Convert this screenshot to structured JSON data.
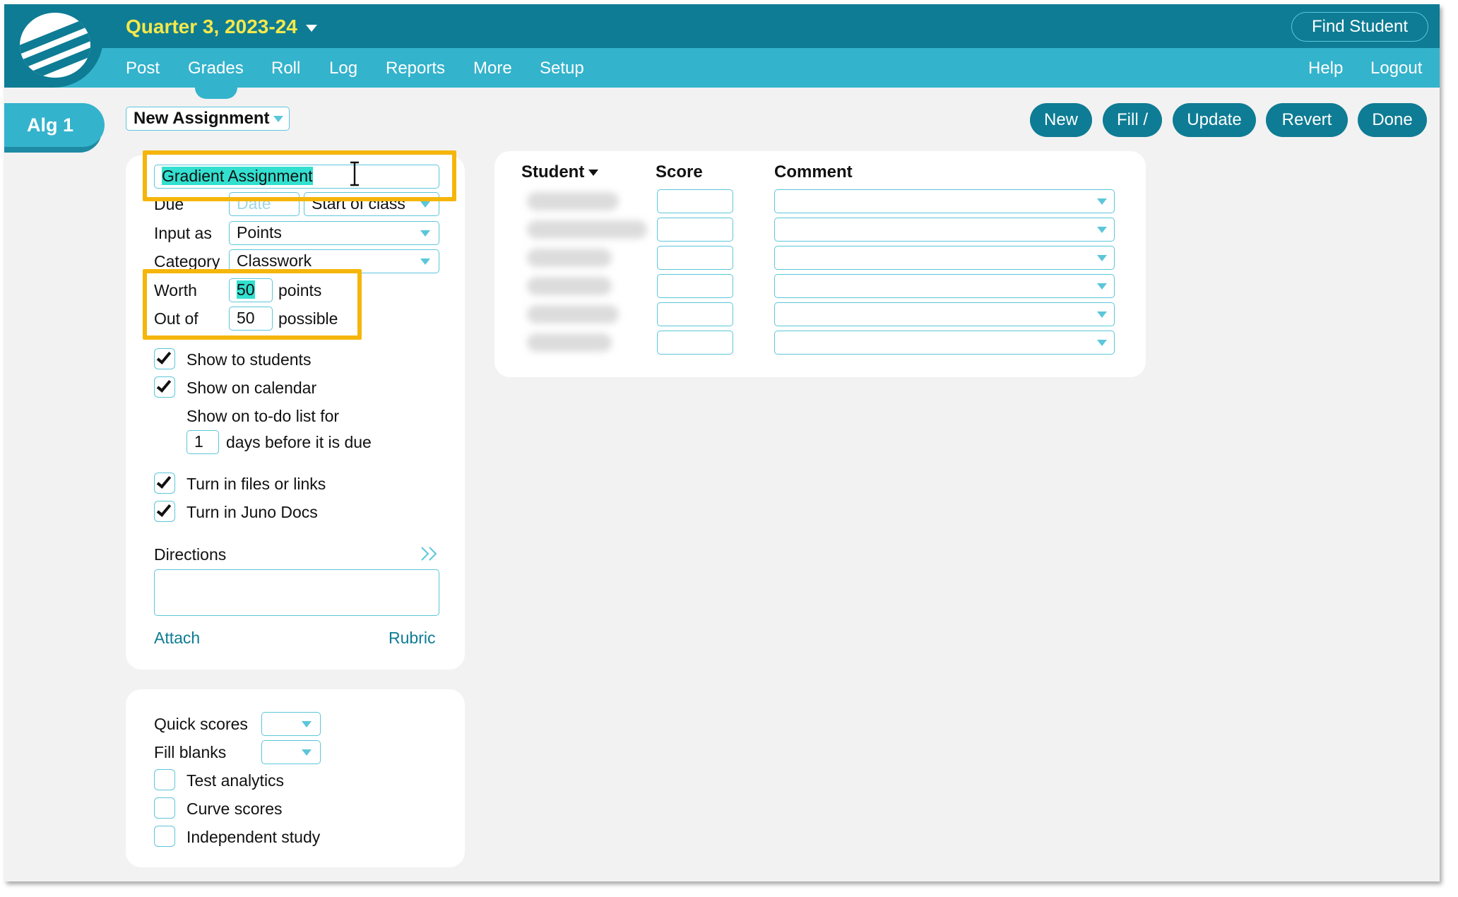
{
  "header": {
    "quarter": "Quarter 3, 2023-24",
    "find_student": "Find Student",
    "nav": [
      "Post",
      "Grades",
      "Roll",
      "Log",
      "Reports",
      "More",
      "Setup"
    ],
    "help": "Help",
    "logout": "Logout"
  },
  "class_tab": "Alg 1",
  "toolbar": {
    "assignment_select": "New Assignment",
    "buttons": [
      "New",
      "Fill /",
      "Update",
      "Revert",
      "Done"
    ]
  },
  "assignment": {
    "name": "Gradient Assignment",
    "due_label": "Due",
    "due_date_placeholder": "Date",
    "due_time": "Start of class",
    "input_as_label": "Input as",
    "input_as": "Points",
    "category_label": "Category",
    "category": "Classwork",
    "worth_label": "Worth",
    "worth": "50",
    "worth_unit": "points",
    "out_of_label": "Out of",
    "out_of": "50",
    "out_of_unit": "possible",
    "show_to_students": "Show to students",
    "show_on_calendar": "Show on calendar",
    "todo_text": "Show on to-do list for",
    "todo_days": "1",
    "todo_suffix": "days before it is due",
    "turn_in_files": "Turn in files or links",
    "turn_in_docs": "Turn in Juno Docs",
    "directions_label": "Directions",
    "attach": "Attach",
    "rubric": "Rubric"
  },
  "options": {
    "quick_scores": "Quick scores",
    "fill_blanks": "Fill blanks",
    "test_analytics": "Test analytics",
    "curve_scores": "Curve scores",
    "independent_study": "Independent study"
  },
  "grid": {
    "col_student": "Student",
    "col_score": "Score",
    "col_comment": "Comment",
    "row_count": 6
  },
  "colors": {
    "header_dark": "#0e7c94",
    "header_light": "#34b3cc",
    "quarter_text": "#f5e84a",
    "field_border": "#5cc6da",
    "callout": "#f5b50a",
    "selection": "#33e0d0"
  }
}
